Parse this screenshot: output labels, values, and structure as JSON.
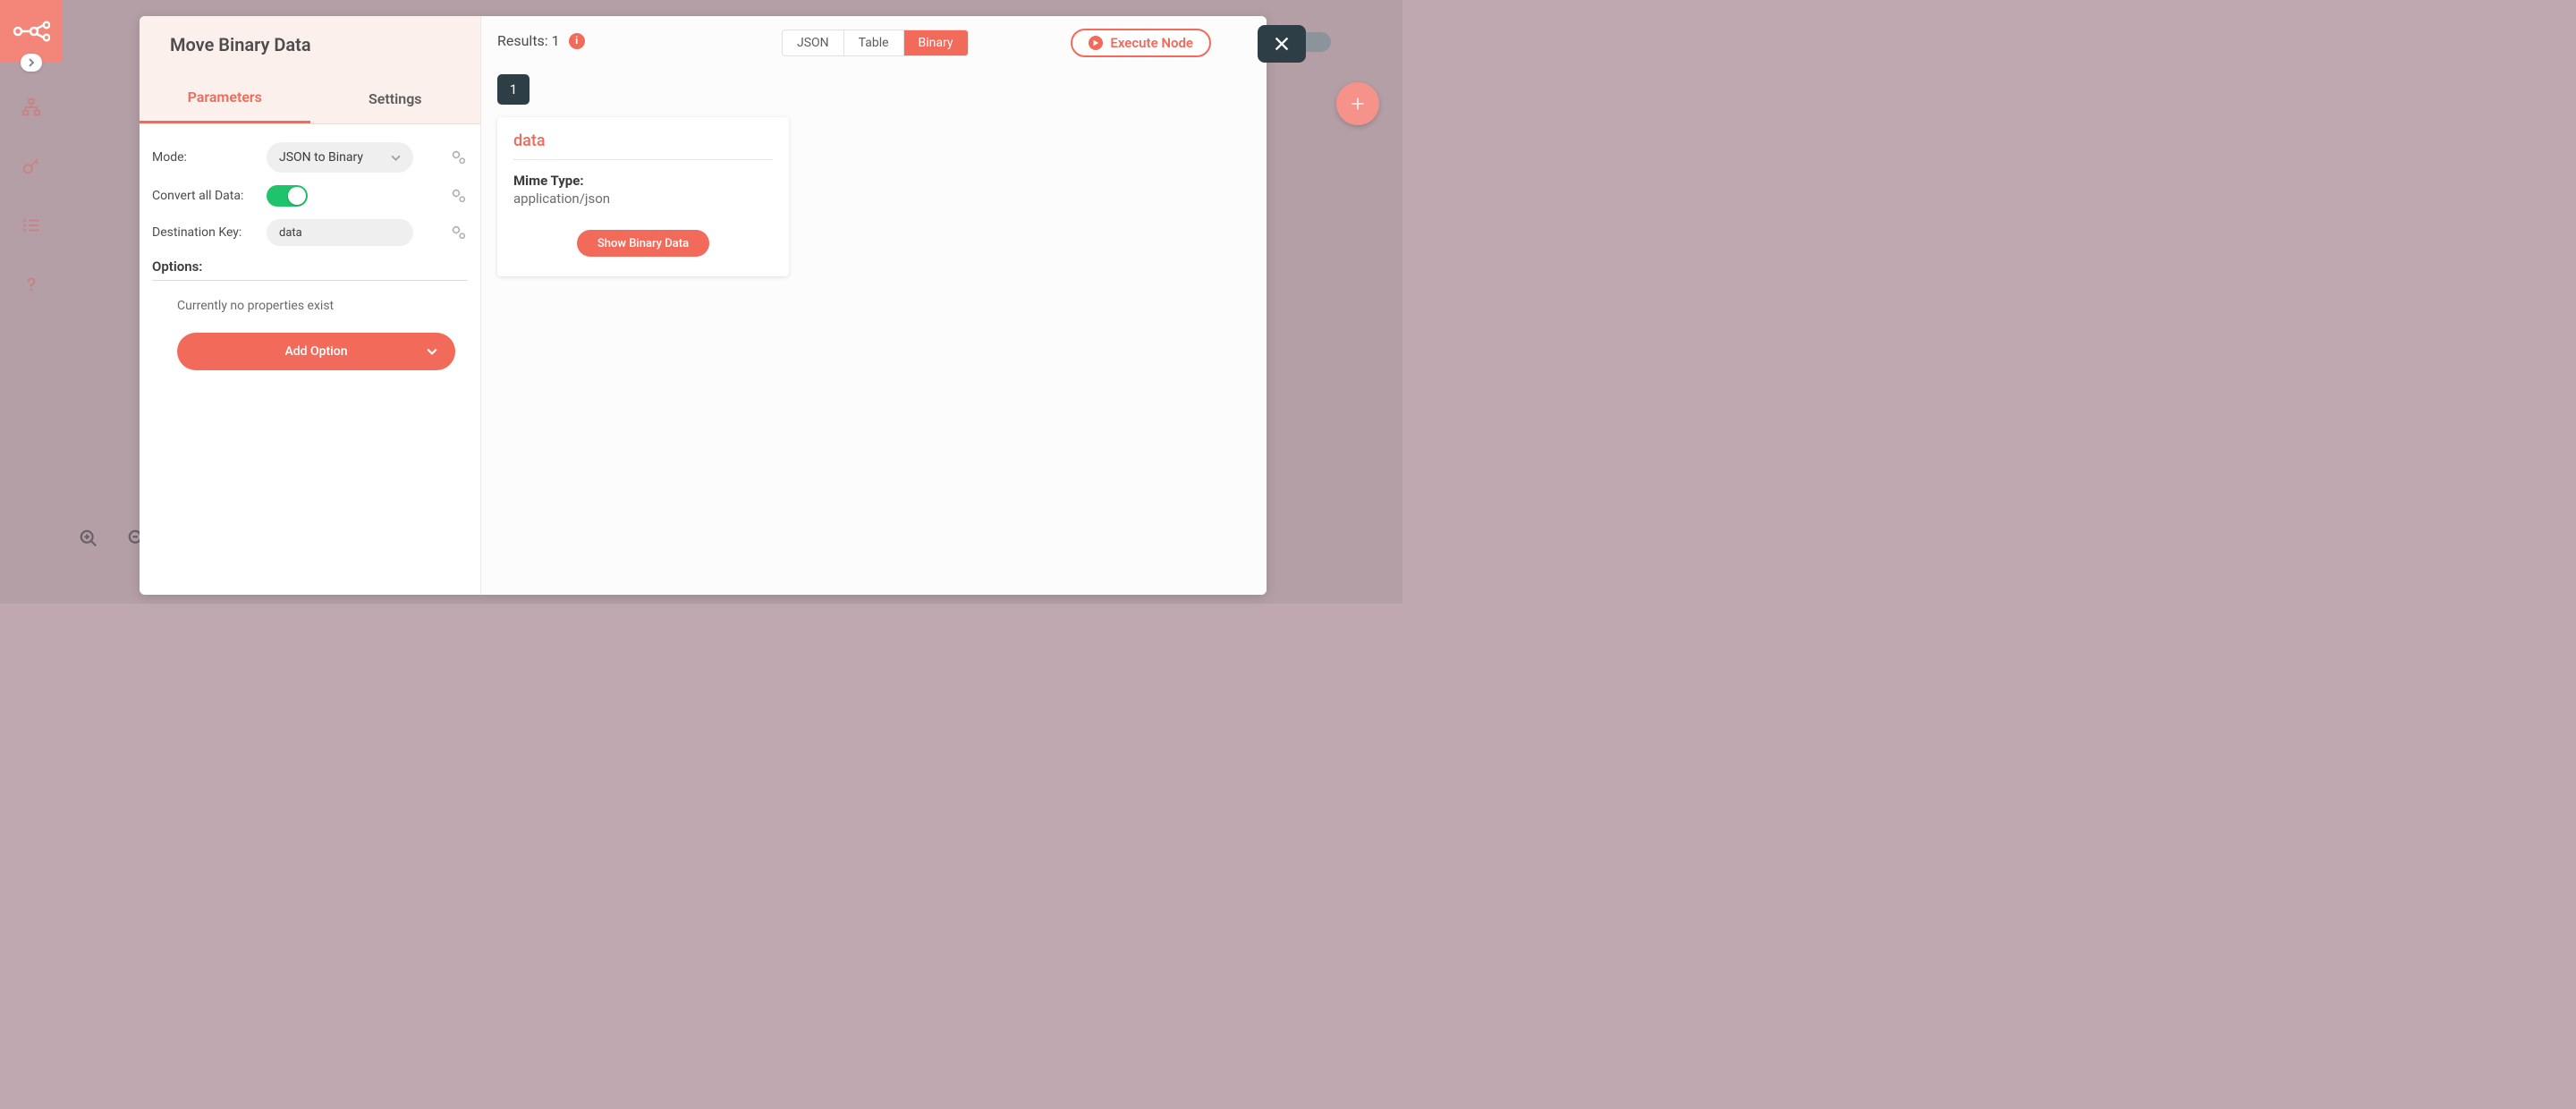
{
  "sidebar": {
    "logo": "n8n"
  },
  "modal": {
    "title": "Move Binary Data",
    "tabs": {
      "parameters": "Parameters",
      "settings": "Settings"
    },
    "params": {
      "mode_label": "Mode:",
      "mode_value": "JSON to Binary",
      "convert_label": "Convert all Data:",
      "convert_value": true,
      "dest_key_label": "Destination Key:",
      "dest_key_value": "data"
    },
    "options_header": "Options:",
    "no_properties_text": "Currently no properties exist",
    "add_option_label": "Add Option"
  },
  "results": {
    "label_prefix": "Results: ",
    "count": "1",
    "views": {
      "json": "JSON",
      "table": "Table",
      "binary": "Binary"
    },
    "execute_label": "Execute Node",
    "index_label": "1",
    "card": {
      "title": "data",
      "mime_label": "Mime Type:",
      "mime_value": "application/json",
      "show_binary_label": "Show Binary Data"
    }
  }
}
